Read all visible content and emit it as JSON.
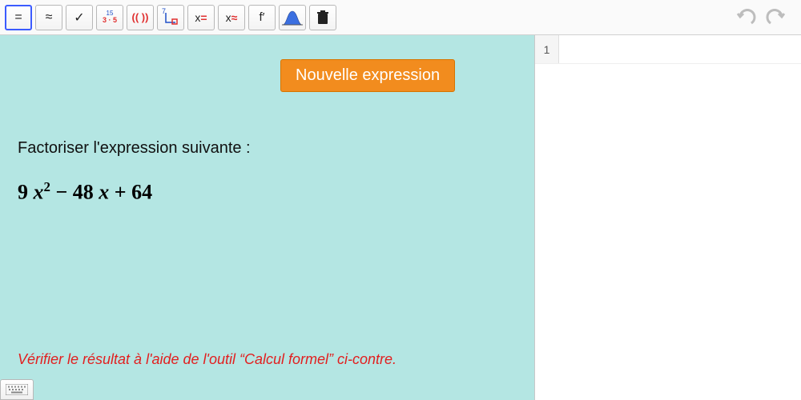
{
  "toolbar": {
    "equals": "=",
    "approx": "≈",
    "check": "✓",
    "factor_top": "15",
    "factor_bot": "3 · 5",
    "paren": "(( ))",
    "angle_sup": "7",
    "xeq_var": "x",
    "xeq_sym": "=",
    "xapx_var": "x",
    "xapx_sym": "≈",
    "derivative": "f′",
    "trash": ""
  },
  "button": {
    "new_expression": "Nouvelle expression"
  },
  "text": {
    "instruction": "Factoriser l'expression suivante :",
    "hint": "Vérifier le résultat à l'aide de l'outil “Calcul formel” ci-contre."
  },
  "expression": {
    "a": "9",
    "var1": "x",
    "exp1": "2",
    "op1": " − ",
    "b": "48",
    "var2": "x",
    "op2": " + ",
    "c": "64"
  },
  "cas": {
    "row1_index": "1",
    "row1_value": ""
  }
}
